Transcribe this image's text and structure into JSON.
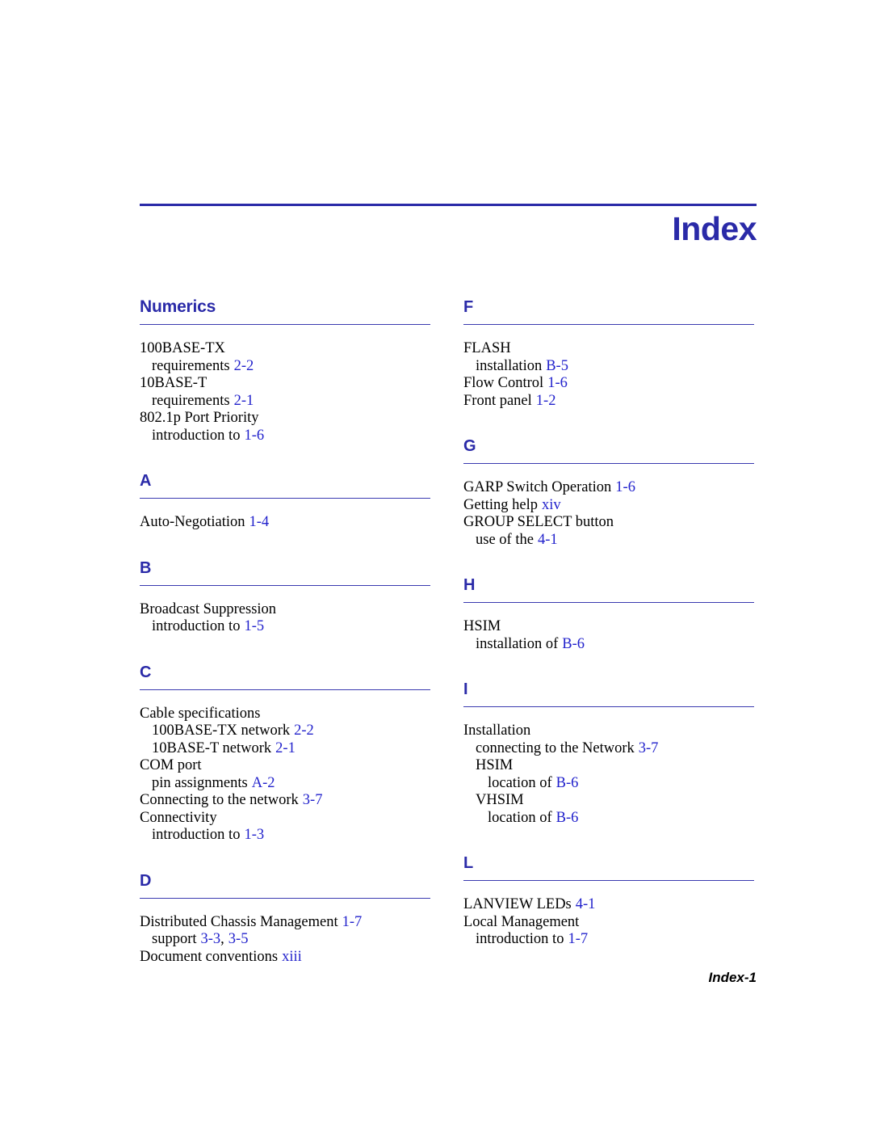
{
  "header": {
    "title": "Index"
  },
  "footer": {
    "page_label": "Index-1"
  },
  "colors": {
    "heading_blue": "#2A2AA8",
    "reference_blue": "#2222CC",
    "rule_blue": "#3A3AB0",
    "body_black": "#000000"
  },
  "columns": [
    {
      "name": "left",
      "sections": [
        {
          "heading": "Numerics",
          "entries": [
            {
              "level": 0,
              "text": "100BASE-TX",
              "refs": []
            },
            {
              "level": 1,
              "text": "requirements",
              "refs": [
                "2-2"
              ]
            },
            {
              "level": 0,
              "text": "10BASE-T",
              "refs": []
            },
            {
              "level": 1,
              "text": "requirements",
              "refs": [
                "2-1"
              ]
            },
            {
              "level": 0,
              "text": "802.1p Port Priority",
              "refs": []
            },
            {
              "level": 1,
              "text": "introduction to",
              "refs": [
                "1-6"
              ]
            }
          ]
        },
        {
          "heading": "A",
          "entries": [
            {
              "level": 0,
              "text": "Auto-Negotiation",
              "refs": [
                "1-4"
              ]
            }
          ]
        },
        {
          "heading": "B",
          "entries": [
            {
              "level": 0,
              "text": "Broadcast Suppression",
              "refs": []
            },
            {
              "level": 1,
              "text": "introduction to",
              "refs": [
                "1-5"
              ]
            }
          ]
        },
        {
          "heading": "C",
          "entries": [
            {
              "level": 0,
              "text": "Cable specifications",
              "refs": []
            },
            {
              "level": 1,
              "text": "100BASE-TX network",
              "refs": [
                "2-2"
              ]
            },
            {
              "level": 1,
              "text": "10BASE-T network",
              "refs": [
                "2-1"
              ]
            },
            {
              "level": 0,
              "text": "COM port",
              "refs": []
            },
            {
              "level": 1,
              "text": "pin assignments",
              "refs": [
                "A-2"
              ]
            },
            {
              "level": 0,
              "text": "Connecting to the network",
              "refs": [
                "3-7"
              ]
            },
            {
              "level": 0,
              "text": "Connectivity",
              "refs": []
            },
            {
              "level": 1,
              "text": "introduction to",
              "refs": [
                "1-3"
              ]
            }
          ]
        },
        {
          "heading": "D",
          "entries": [
            {
              "level": 0,
              "text": "Distributed Chassis Management",
              "refs": [
                "1-7"
              ]
            },
            {
              "level": 1,
              "text": "support",
              "refs": [
                "3-3",
                "3-5"
              ]
            },
            {
              "level": 0,
              "text": "Document conventions",
              "refs": [
                "xiii"
              ]
            }
          ]
        }
      ]
    },
    {
      "name": "right",
      "sections": [
        {
          "heading": "F",
          "entries": [
            {
              "level": 0,
              "text": "FLASH",
              "refs": []
            },
            {
              "level": 1,
              "text": "installation",
              "refs": [
                "B-5"
              ]
            },
            {
              "level": 0,
              "text": "Flow Control",
              "refs": [
                "1-6"
              ]
            },
            {
              "level": 0,
              "text": "Front panel",
              "refs": [
                "1-2"
              ]
            }
          ]
        },
        {
          "heading": "G",
          "entries": [
            {
              "level": 0,
              "text": "GARP Switch Operation",
              "refs": [
                "1-6"
              ]
            },
            {
              "level": 0,
              "text": "Getting help",
              "refs": [
                "xiv"
              ]
            },
            {
              "level": 0,
              "text": "GROUP SELECT button",
              "refs": []
            },
            {
              "level": 1,
              "text": "use of the",
              "refs": [
                "4-1"
              ]
            }
          ]
        },
        {
          "heading": "H",
          "entries": [
            {
              "level": 0,
              "text": "HSIM",
              "refs": []
            },
            {
              "level": 1,
              "text": "installation of",
              "refs": [
                "B-6"
              ]
            }
          ]
        },
        {
          "heading": "I",
          "entries": [
            {
              "level": 0,
              "text": "Installation",
              "refs": []
            },
            {
              "level": 1,
              "text": "connecting to the Network",
              "refs": [
                "3-7"
              ]
            },
            {
              "level": 1,
              "text": "HSIM",
              "refs": []
            },
            {
              "level": 2,
              "text": "location of",
              "refs": [
                "B-6"
              ]
            },
            {
              "level": 1,
              "text": "VHSIM",
              "refs": []
            },
            {
              "level": 2,
              "text": "location of",
              "refs": [
                "B-6"
              ]
            }
          ]
        },
        {
          "heading": "L",
          "entries": [
            {
              "level": 0,
              "text": "LANVIEW LEDs",
              "refs": [
                "4-1"
              ]
            },
            {
              "level": 0,
              "text": "Local Management",
              "refs": []
            },
            {
              "level": 1,
              "text": "introduction to",
              "refs": [
                "1-7"
              ]
            }
          ]
        }
      ]
    }
  ]
}
